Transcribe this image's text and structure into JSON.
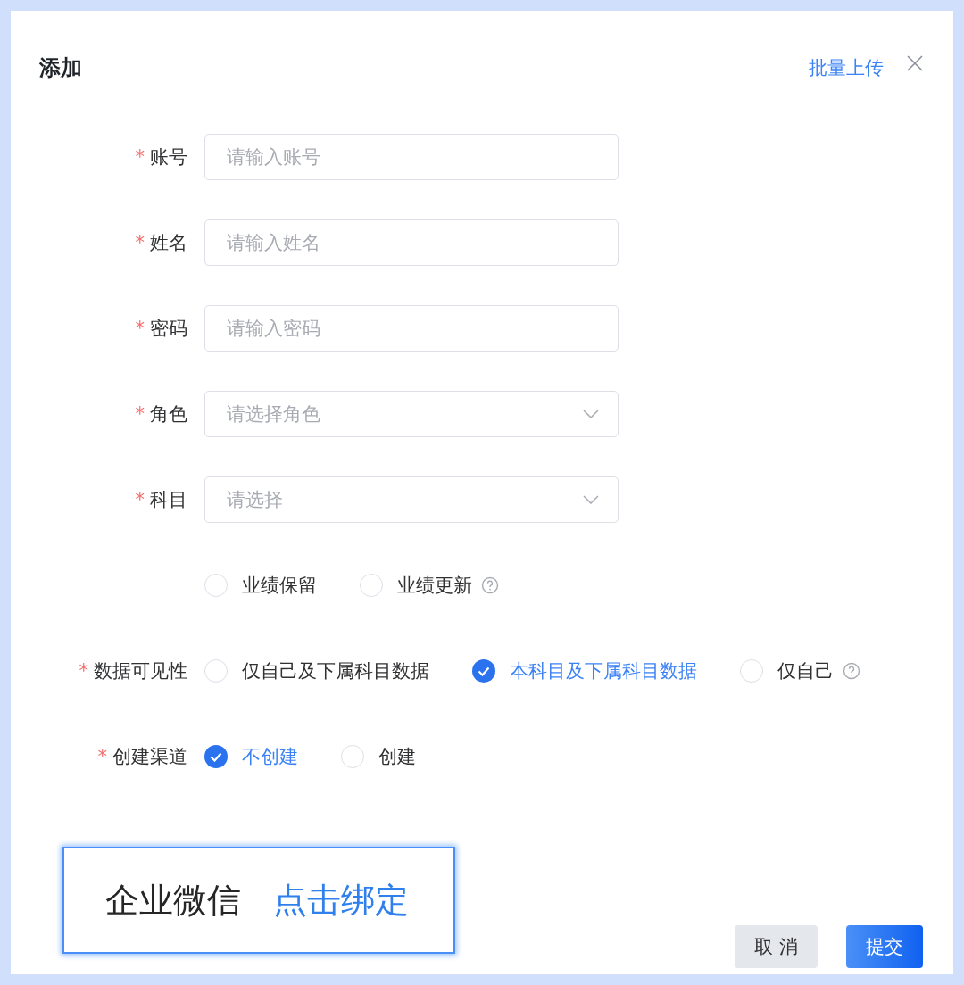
{
  "dialog": {
    "title": "添加",
    "bulk_upload": "批量上传"
  },
  "required_mark": "*",
  "fields": [
    {
      "label": "账号",
      "required": true,
      "kind": "input",
      "placeholder": "请输入账号"
    },
    {
      "label": "姓名",
      "required": true,
      "kind": "input",
      "placeholder": "请输入姓名"
    },
    {
      "label": "密码",
      "required": true,
      "kind": "input",
      "placeholder": "请输入密码"
    },
    {
      "label": "角色",
      "required": true,
      "kind": "select",
      "placeholder": "请选择角色"
    },
    {
      "label": "科目",
      "required": true,
      "kind": "select",
      "placeholder": "请选择"
    }
  ],
  "radio_groups": [
    {
      "has_help": true,
      "options": [
        {
          "label": "业绩保留",
          "selected": false
        },
        {
          "label": "业绩更新",
          "selected": false
        }
      ]
    },
    {
      "label": "数据可见性",
      "required": true,
      "has_help": true,
      "options": [
        {
          "label": "仅自己及下属科目数据",
          "selected": false
        },
        {
          "label": "本科目及下属科目数据",
          "selected": true
        },
        {
          "label": "仅自己",
          "selected": false
        }
      ]
    },
    {
      "label": "创建渠道",
      "required": true,
      "options": [
        {
          "label": "不创建",
          "selected": true
        },
        {
          "label": "创建",
          "selected": false
        }
      ]
    }
  ],
  "wechat_bind": {
    "label": "企业微信",
    "link": "点击绑定"
  },
  "buttons": [
    {
      "label": "取 消",
      "kind": "secondary"
    },
    {
      "label": "提交",
      "kind": "primary"
    }
  ]
}
